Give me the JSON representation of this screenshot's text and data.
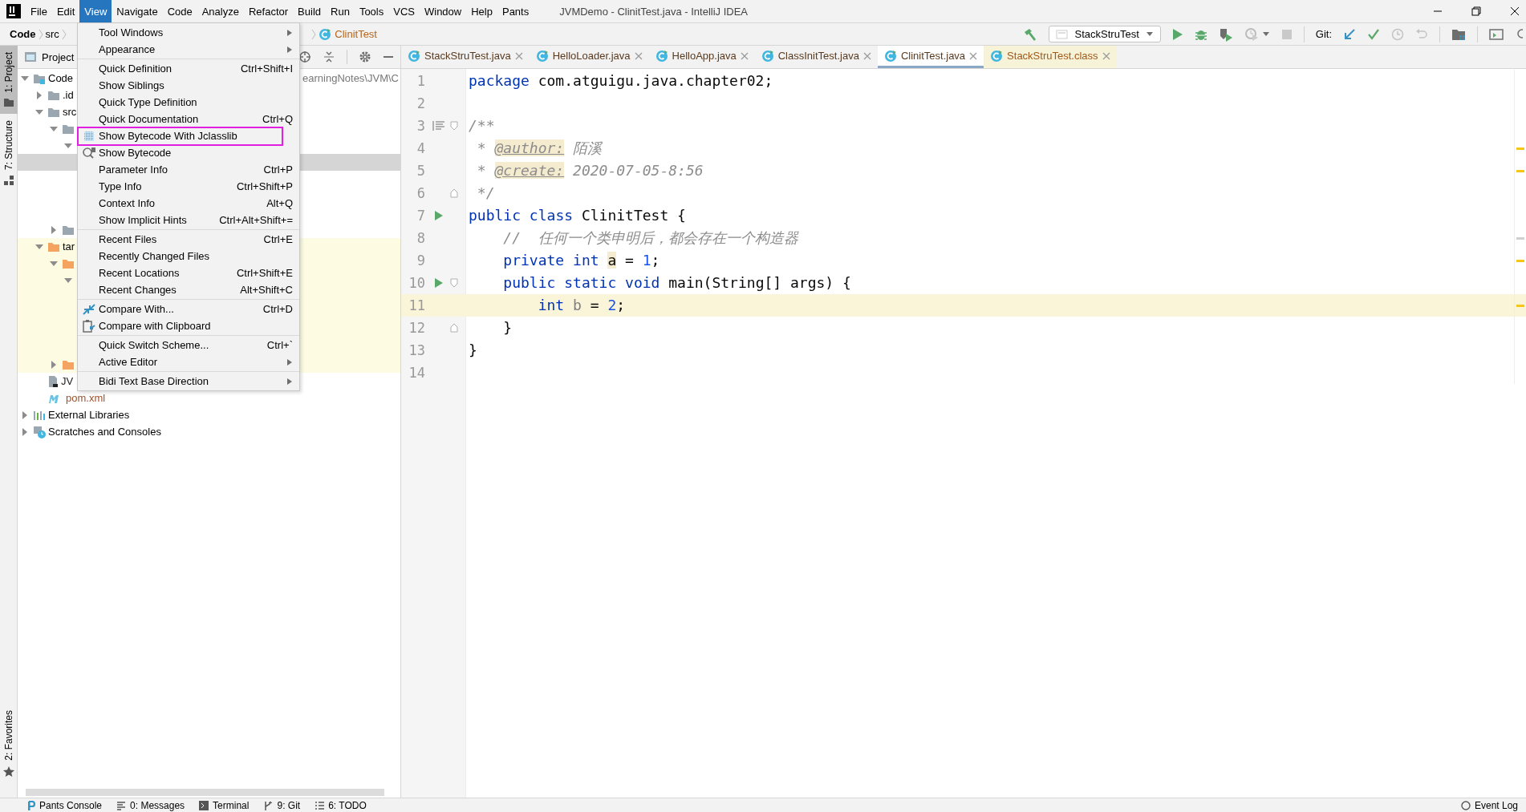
{
  "window": {
    "title": "JVMDemo - ClinitTest.java - IntelliJ IDEA"
  },
  "menu_bar": [
    {
      "label": "File",
      "selected": false
    },
    {
      "label": "Edit",
      "selected": false
    },
    {
      "label": "View",
      "selected": true
    },
    {
      "label": "Navigate",
      "selected": false
    },
    {
      "label": "Code",
      "selected": false
    },
    {
      "label": "Analyze",
      "selected": false
    },
    {
      "label": "Refactor",
      "selected": false
    },
    {
      "label": "Build",
      "selected": false
    },
    {
      "label": "Run",
      "selected": false
    },
    {
      "label": "Tools",
      "selected": false
    },
    {
      "label": "VCS",
      "selected": false
    },
    {
      "label": "Window",
      "selected": false
    },
    {
      "label": "Help",
      "selected": false
    },
    {
      "label": "Pants",
      "selected": false
    }
  ],
  "navigation_bar": {
    "breadcrumbs": [
      {
        "label": "Code",
        "kind": "project"
      },
      {
        "label": "src",
        "kind": "folder"
      },
      {
        "label": "ClinitTest",
        "kind": "class"
      }
    ],
    "run_configuration": "StackStruTest",
    "vcs_label": "Git:"
  },
  "tool_strip": {
    "top": [
      {
        "label": "1: Project",
        "kind": "project",
        "selected": true
      },
      {
        "label": "7: Structure",
        "kind": "structure",
        "selected": false
      }
    ],
    "bottom": [
      {
        "label": "2: Favorites",
        "kind": "favorites",
        "selected": false
      }
    ]
  },
  "project_pane": {
    "title": "Project",
    "tree": [
      {
        "label": "Code",
        "kind": "module",
        "hint": "earningNotes\\JVM\\C",
        "expanded": true,
        "selected": false,
        "children": [
          {
            "label": ".id",
            "kind": "folder",
            "expanded": false,
            "selected": false
          },
          {
            "label": "src",
            "kind": "folder",
            "expanded": true,
            "selected": false,
            "children": [
              {
                "kind": "folder",
                "expanded": true,
                "selected": false,
                "children": [
                  {
                    "expanded": true,
                    "selected": false,
                    "children": [
                      {
                        "selected": true
                      }
                    ]
                  }
                ]
              },
              {
                "kind": "folder",
                "expanded": false,
                "selected": false
              }
            ]
          },
          {
            "label": "tar",
            "kind": "excluded-folder",
            "expanded": true,
            "selected": false,
            "children": [
              {
                "kind": "excluded-folder",
                "expanded": true,
                "selected": false,
                "children": [
                  {
                    "expanded": true,
                    "selected": false
                  }
                ]
              },
              {
                "kind": "excluded-folder",
                "expanded": false,
                "selected": false
              }
            ]
          },
          {
            "label": "JV",
            "kind": "module-file",
            "selected": false
          },
          {
            "label": "pom.xml",
            "kind": "maven",
            "selected": false
          }
        ]
      },
      {
        "label": "External Libraries",
        "kind": "libraries",
        "expanded": false,
        "selected": false
      },
      {
        "label": "Scratches and Consoles",
        "kind": "scratches",
        "expanded": false,
        "selected": false
      }
    ]
  },
  "editor": {
    "tabs": [
      {
        "label": "StackStruTest.java",
        "kind": "java",
        "selected": false
      },
      {
        "label": "HelloLoader.java",
        "kind": "java",
        "selected": false
      },
      {
        "label": "HelloApp.java",
        "kind": "java",
        "selected": false
      },
      {
        "label": "ClassInitTest.java",
        "kind": "java",
        "selected": false
      },
      {
        "label": "ClinitTest.java",
        "kind": "java",
        "selected": true
      },
      {
        "label": "StackStruTest.class",
        "kind": "class",
        "selected": false
      }
    ],
    "lines": [
      {
        "number": "1",
        "current": false,
        "tokens": [
          {
            "text": "package",
            "kind": "keyword"
          },
          {
            "text": " com.atguigu.java.chapter02;",
            "kind": "plain"
          }
        ]
      },
      {
        "number": "2",
        "current": false
      },
      {
        "number": "3",
        "current": false,
        "gutter": [
          {
            "kind": "doc"
          },
          {
            "kind": "fold-start"
          }
        ],
        "tokens": [
          {
            "text": "/**",
            "kind": "comment"
          }
        ]
      },
      {
        "number": "4",
        "current": false,
        "stripe": {
          "color": "#f5c518"
        },
        "tokens": [
          {
            "text": " * ",
            "kind": "comment"
          },
          {
            "text": "@author:",
            "kind": "doctag"
          },
          {
            "text": " 陌溪",
            "kind": "comment"
          }
        ]
      },
      {
        "number": "5",
        "current": false,
        "stripe": {
          "color": "#f5c518"
        },
        "tokens": [
          {
            "text": " * ",
            "kind": "comment"
          },
          {
            "text": "@create:",
            "kind": "doctag"
          },
          {
            "text": " 2020-07-05-8:56",
            "kind": "comment"
          }
        ]
      },
      {
        "number": "6",
        "current": false,
        "gutter": [
          {
            "kind": "fold-end"
          }
        ],
        "tokens": [
          {
            "text": " */",
            "kind": "comment"
          }
        ]
      },
      {
        "number": "7",
        "current": false,
        "gutter": [
          {
            "kind": "run"
          }
        ],
        "tokens": [
          {
            "text": "public",
            "kind": "keyword"
          },
          {
            "text": " class",
            "kind": "keyword"
          },
          {
            "text": " ClinitTest {",
            "kind": "plain"
          }
        ]
      },
      {
        "number": "8",
        "current": false,
        "stripe": {
          "color": "#d0d0d0"
        },
        "tokens": [
          {
            "text": "    //  任何一个类申明后，都会存在一个构造器",
            "kind": "comment"
          }
        ]
      },
      {
        "number": "9",
        "current": false,
        "stripe": {
          "color": "#f5c518"
        },
        "tokens": [
          {
            "text": "    private",
            "kind": "keyword"
          },
          {
            "text": " int ",
            "kind": "keyword"
          },
          {
            "text": "a",
            "kind": "usage"
          },
          {
            "text": " = ",
            "kind": "plain"
          },
          {
            "text": "1",
            "kind": "number"
          },
          {
            "text": ";",
            "kind": "plain"
          }
        ]
      },
      {
        "number": "10",
        "current": false,
        "gutter": [
          {
            "kind": "run"
          },
          {
            "kind": "fold-start"
          }
        ],
        "tokens": [
          {
            "text": "    public",
            "kind": "keyword"
          },
          {
            "text": " static",
            "kind": "keyword"
          },
          {
            "text": " void",
            "kind": "keyword"
          },
          {
            "text": " main(String[] args) {",
            "kind": "plain"
          }
        ]
      },
      {
        "number": "11",
        "current": true,
        "stripe": {
          "color": "#f5c518"
        },
        "tokens": [
          {
            "text": "        int ",
            "kind": "keyword"
          },
          {
            "text": "b",
            "kind": "unused"
          },
          {
            "text": " = ",
            "kind": "plain"
          },
          {
            "text": "2",
            "kind": "number"
          },
          {
            "text": ";",
            "kind": "plain"
          }
        ]
      },
      {
        "number": "12",
        "current": false,
        "gutter": [
          {
            "kind": "fold-end"
          }
        ],
        "tokens": [
          {
            "text": "    }",
            "kind": "plain"
          }
        ]
      },
      {
        "number": "13",
        "current": false,
        "tokens": [
          {
            "text": "}",
            "kind": "plain"
          }
        ]
      },
      {
        "number": "14",
        "current": false
      }
    ]
  },
  "view_menu": {
    "groups": [
      [
        {
          "label": "Tool Windows",
          "kind": "submenu",
          "outlined": false
        },
        {
          "label": "Appearance",
          "kind": "submenu",
          "outlined": false
        }
      ],
      [
        {
          "label": "Quick Definition",
          "shortcut": "Ctrl+Shift+I",
          "kind": "plain",
          "outlined": false
        },
        {
          "label": "Show Siblings",
          "kind": "plain",
          "outlined": false
        },
        {
          "label": "Quick Type Definition",
          "kind": "plain",
          "outlined": false
        },
        {
          "label": "Quick Documentation",
          "shortcut": "Ctrl+Q",
          "kind": "plain",
          "outlined": false
        },
        {
          "label": "Show Bytecode With Jclasslib",
          "kind": "jclasslib",
          "outlined": true
        },
        {
          "label": "Show Bytecode",
          "kind": "bytecode",
          "outlined": false
        },
        {
          "label": "Parameter Info",
          "shortcut": "Ctrl+P",
          "kind": "plain",
          "outlined": false
        },
        {
          "label": "Type Info",
          "shortcut": "Ctrl+Shift+P",
          "kind": "plain",
          "outlined": false
        },
        {
          "label": "Context Info",
          "shortcut": "Alt+Q",
          "kind": "plain",
          "outlined": false
        },
        {
          "label": "Show Implicit Hints",
          "shortcut": "Ctrl+Alt+Shift+=",
          "kind": "plain",
          "outlined": false
        }
      ],
      [
        {
          "label": "Recent Files",
          "shortcut": "Ctrl+E",
          "kind": "plain",
          "outlined": false
        },
        {
          "label": "Recently Changed Files",
          "kind": "plain",
          "outlined": false
        },
        {
          "label": "Recent Locations",
          "shortcut": "Ctrl+Shift+E",
          "kind": "plain",
          "outlined": false
        },
        {
          "label": "Recent Changes",
          "shortcut": "Alt+Shift+C",
          "kind": "plain",
          "outlined": false
        }
      ],
      [
        {
          "label": "Compare With...",
          "shortcut": "Ctrl+D",
          "kind": "compare",
          "outlined": false
        },
        {
          "label": "Compare with Clipboard",
          "kind": "compare-clipboard",
          "outlined": false
        }
      ],
      [
        {
          "label": "Quick Switch Scheme...",
          "shortcut": "Ctrl+`",
          "kind": "plain",
          "outlined": false
        },
        {
          "label": "Active Editor",
          "kind": "submenu",
          "outlined": false
        }
      ],
      [
        {
          "label": "Bidi Text Base Direction",
          "kind": "submenu",
          "outlined": false
        }
      ]
    ]
  },
  "bottom_bar": {
    "tools": [
      {
        "label": "Pants Console",
        "kind": "pants"
      },
      {
        "label": "0: Messages",
        "kind": "messages"
      },
      {
        "label": "Terminal",
        "kind": "terminal"
      },
      {
        "label": "9: Git",
        "kind": "git"
      },
      {
        "label": "6: TODO",
        "kind": "todo"
      }
    ],
    "event_log": "Event Log"
  }
}
